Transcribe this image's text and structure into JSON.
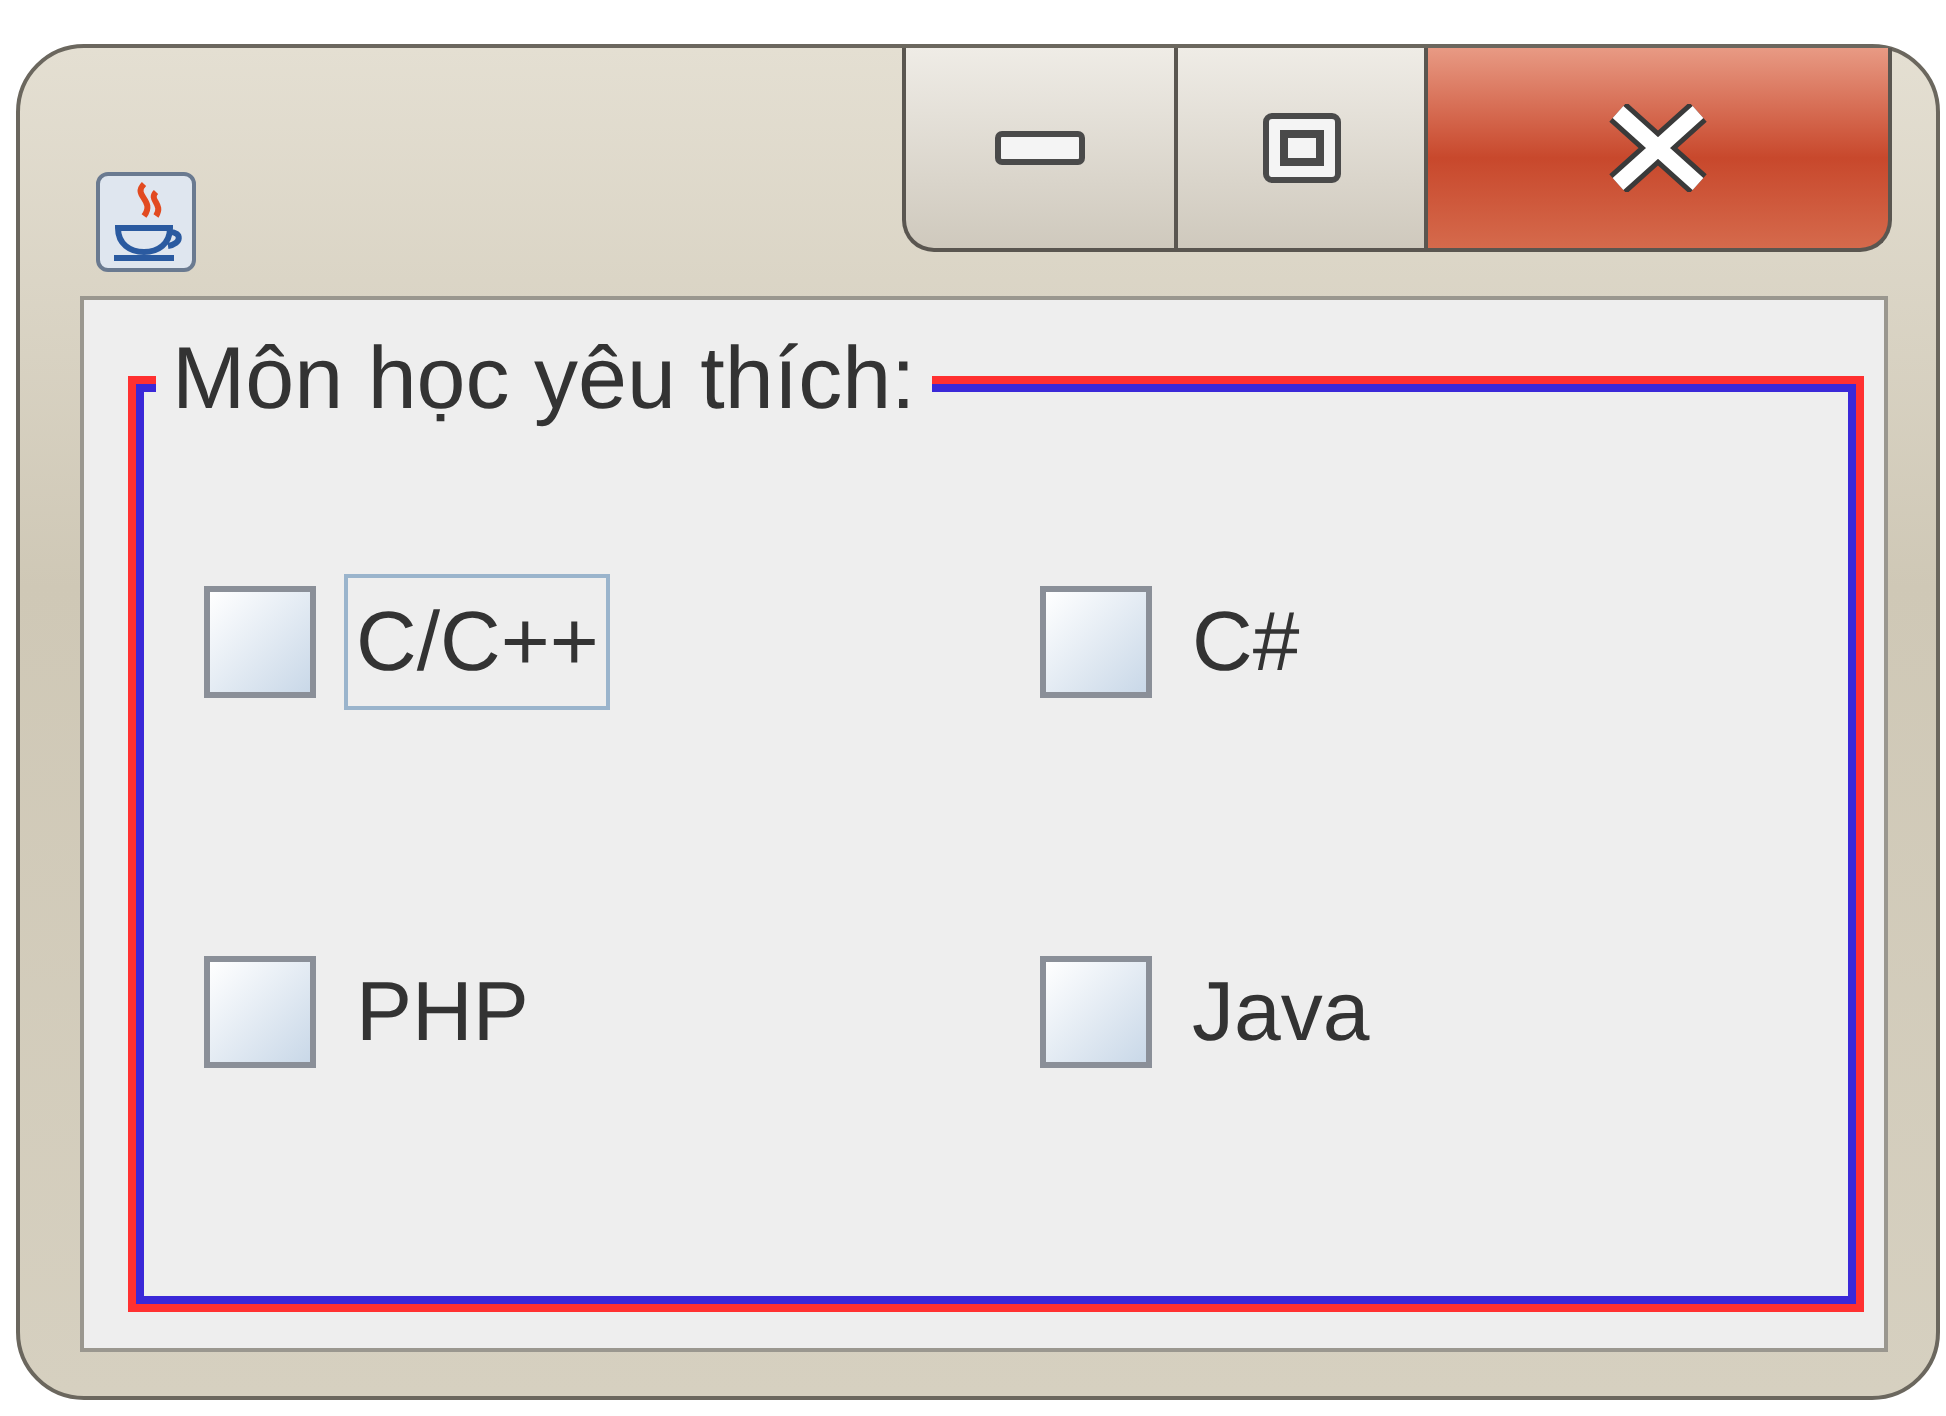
{
  "group": {
    "title": "Môn học yêu thích:",
    "options": [
      {
        "label": "C/C++",
        "checked": false,
        "focused": true
      },
      {
        "label": "C#",
        "checked": false,
        "focused": false
      },
      {
        "label": "PHP",
        "checked": false,
        "focused": false
      },
      {
        "label": "Java",
        "checked": false,
        "focused": false
      }
    ]
  }
}
